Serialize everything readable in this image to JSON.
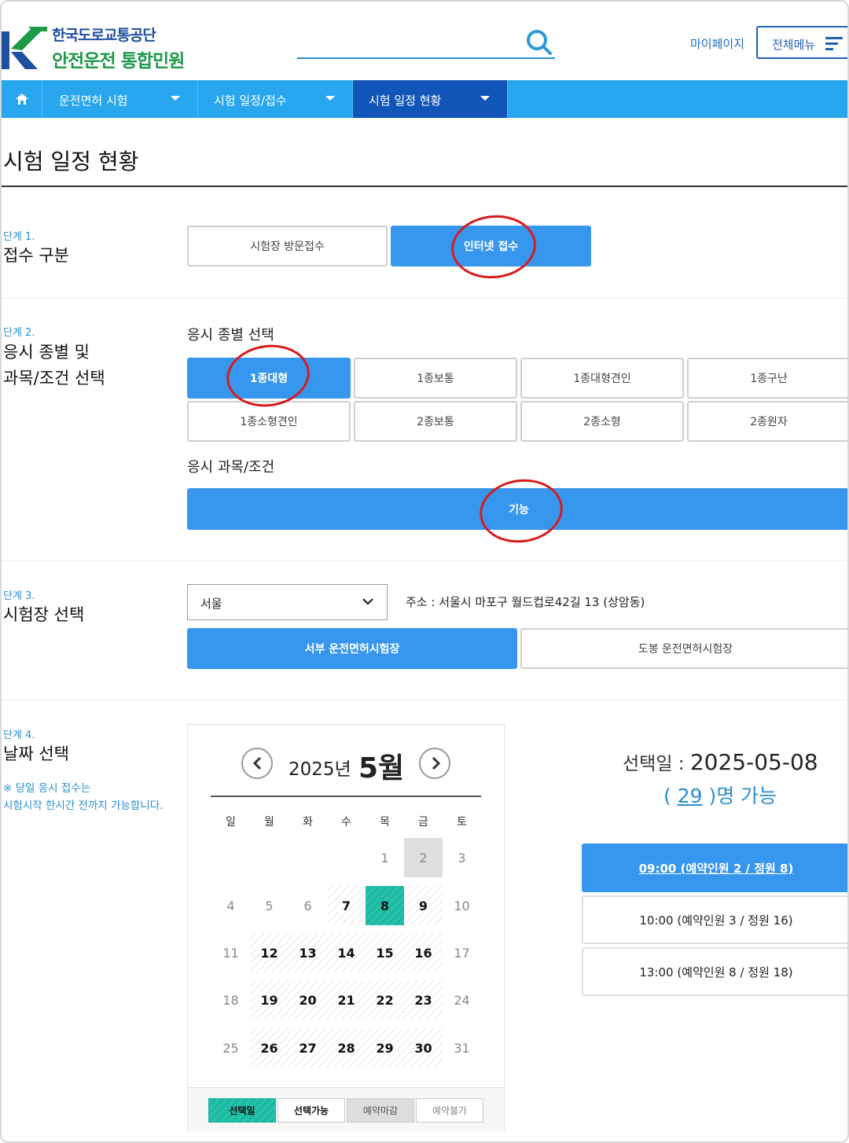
{
  "header": {
    "logo_line1": "한국도로교통공단",
    "logo_line2": "안전운전 통합민원",
    "mypage": "마이페이지",
    "allmenu": "전체메뉴"
  },
  "nav": {
    "items": [
      {
        "label": "운전면허 시험"
      },
      {
        "label": "시험 일정/접수"
      },
      {
        "label": "시험 일정 현황"
      }
    ]
  },
  "page_title": "시험 일정 현황",
  "step1": {
    "no": "단계 1.",
    "title": "접수 구분",
    "options": [
      "시험장 방문접수",
      "인터넷 접수"
    ]
  },
  "step2": {
    "no": "단계 2.",
    "title_line1": "응시 종별 및",
    "title_line2": "과목/조건 선택",
    "type_heading": "응시 종별 선택",
    "types": [
      "1종대형",
      "1종보통",
      "1종대형견인",
      "1종구난",
      "1종소형견인",
      "2종보통",
      "2종소형",
      "2종원자"
    ],
    "subject_heading": "응시 과목/조건",
    "subject": "기능"
  },
  "step3": {
    "no": "단계 3.",
    "title": "시험장 선택",
    "region": "서울",
    "address": "주소 : 서울시 마포구 월드컵로42길 13 (상암동)",
    "centers": [
      "서부 운전면허시험장",
      "도봉 운전면허시험장"
    ]
  },
  "step4": {
    "no": "단계 4.",
    "title": "날짜 선택",
    "notice_line1": "※ 당일 응시 접수는",
    "notice_line2": "시험시작 한시간 전까지 가능합니다."
  },
  "calendar": {
    "year_label": "2025년",
    "month_label": "5월",
    "weekdays": [
      "일",
      "월",
      "화",
      "수",
      "목",
      "금",
      "토"
    ],
    "weeks": [
      [
        {
          "d": ""
        },
        {
          "d": ""
        },
        {
          "d": ""
        },
        {
          "d": ""
        },
        {
          "d": "1",
          "s": "na"
        },
        {
          "d": "2",
          "s": "closed"
        },
        {
          "d": "3",
          "s": "na"
        }
      ],
      [
        {
          "d": "4",
          "s": "na"
        },
        {
          "d": "5",
          "s": "na"
        },
        {
          "d": "6",
          "s": "na"
        },
        {
          "d": "7",
          "s": "avail"
        },
        {
          "d": "8",
          "s": "sel"
        },
        {
          "d": "9",
          "s": "avail"
        },
        {
          "d": "10",
          "s": "na"
        }
      ],
      [
        {
          "d": "11",
          "s": "na"
        },
        {
          "d": "12",
          "s": "avail"
        },
        {
          "d": "13",
          "s": "avail"
        },
        {
          "d": "14",
          "s": "avail"
        },
        {
          "d": "15",
          "s": "avail"
        },
        {
          "d": "16",
          "s": "avail"
        },
        {
          "d": "17",
          "s": "na"
        }
      ],
      [
        {
          "d": "18",
          "s": "na"
        },
        {
          "d": "19",
          "s": "avail"
        },
        {
          "d": "20",
          "s": "avail"
        },
        {
          "d": "21",
          "s": "avail"
        },
        {
          "d": "22",
          "s": "avail"
        },
        {
          "d": "23",
          "s": "avail"
        },
        {
          "d": "24",
          "s": "na"
        }
      ],
      [
        {
          "d": "25",
          "s": "na"
        },
        {
          "d": "26",
          "s": "avail"
        },
        {
          "d": "27",
          "s": "avail"
        },
        {
          "d": "28",
          "s": "avail"
        },
        {
          "d": "29",
          "s": "avail"
        },
        {
          "d": "30",
          "s": "avail"
        },
        {
          "d": "31",
          "s": "na"
        }
      ]
    ],
    "legend": [
      "선택일",
      "선택가능",
      "예약마감",
      "예약불가"
    ]
  },
  "selection": {
    "label": "선택일 : ",
    "date": "2025-05-08",
    "cap_open": "( ",
    "cap_num": "29",
    "cap_close": " )명 가능"
  },
  "slots": [
    "09:00 (예약인원 2 / 정원 8)",
    "10:00 (예약인원 3 / 정원 16)",
    "13:00 (예약인원 8 / 정원 18)"
  ],
  "colors": {
    "primary": "#3797ee",
    "nav": "#28a7ef",
    "nav_active": "#1255b8",
    "selected_day": "#22c3aa",
    "annotation": "#d81b1b"
  }
}
